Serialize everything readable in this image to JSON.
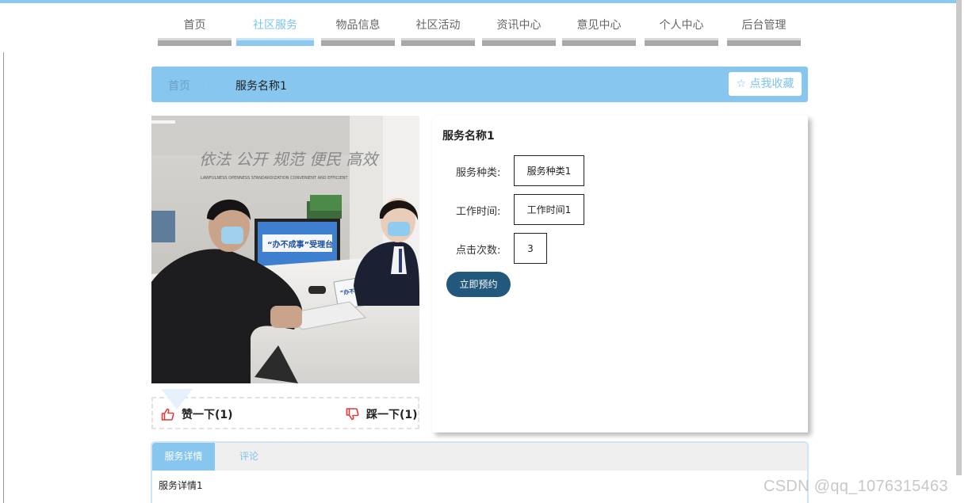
{
  "nav": {
    "items": [
      {
        "label": "首页",
        "active": false
      },
      {
        "label": "社区服务",
        "active": true
      },
      {
        "label": "物品信息",
        "active": false
      },
      {
        "label": "社区活动",
        "active": false
      },
      {
        "label": "资讯中心",
        "active": false
      },
      {
        "label": "意见中心",
        "active": false
      },
      {
        "label": "个人中心",
        "active": false
      },
      {
        "label": "后台管理",
        "active": false
      }
    ]
  },
  "breadcrumb": {
    "home": "首页",
    "separator": "/",
    "current": "服务名称1"
  },
  "favorite_button": "☆ 点我收藏",
  "vote": {
    "like": "赞一下(1)",
    "dislike": "踩一下(1)"
  },
  "service": {
    "name": "服务名称1",
    "fields": [
      {
        "label": "服务种类:",
        "value": "服务种类1"
      },
      {
        "label": "工作时间:",
        "value": "工作时间1"
      },
      {
        "label": "点击次数:",
        "value": "3"
      }
    ],
    "book_button": "立即预约"
  },
  "detail": {
    "tabs": [
      "服务详情",
      "评论"
    ],
    "active_tab": 0,
    "content": "服务详情1"
  },
  "watermark": "CSDN @qq_1076315463",
  "colors": {
    "accent": "#86c6ef",
    "accent_text": "#7cc4ee",
    "book_button": "#22587c",
    "like_icon": "#e03a3a"
  },
  "photo_signs": {
    "wall_slogan": "依法 公开 规范 便民 高效",
    "wall_slogan_en": "LAWFULNESS  OPENNESS  STANDARDIZATION  CONVENIENT AND EFFICIENT",
    "screen_title": "“办不成事”受理台",
    "desk_sign": "“办不成事”受理台"
  }
}
